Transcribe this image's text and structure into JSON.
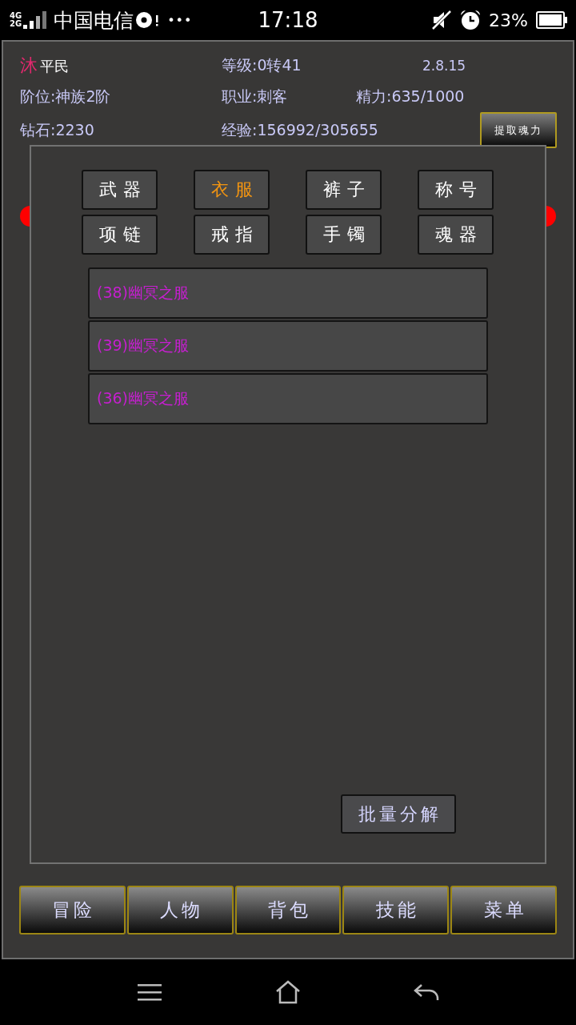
{
  "status_bar": {
    "network": [
      "4G",
      "2G"
    ],
    "carrier": "中国电信",
    "overflow": "•••",
    "time": "17:18",
    "battery": "23%"
  },
  "player": {
    "name": "沐",
    "rank": "平民",
    "level": "等级:0转41",
    "version": "2.8.15",
    "tier": "阶位:神族2阶",
    "job": "职业:刺客",
    "energy": "精力:635/1000",
    "diamonds": "钻石:2230",
    "experience": "经验:156992/305655",
    "extract_button": "提取魂力"
  },
  "dialog": {
    "tabs": [
      {
        "label": "武器",
        "selected": false
      },
      {
        "label": "衣服",
        "selected": true
      },
      {
        "label": "裤子",
        "selected": false
      },
      {
        "label": "称号",
        "selected": false
      },
      {
        "label": "项链",
        "selected": false
      },
      {
        "label": "戒指",
        "selected": false
      },
      {
        "label": "手镯",
        "selected": false
      },
      {
        "label": "魂器",
        "selected": false
      }
    ],
    "items": [
      {
        "label": "(38)幽冥之服"
      },
      {
        "label": "(39)幽冥之服"
      },
      {
        "label": "(36)幽冥之服"
      }
    ],
    "action_button": "批量分解"
  },
  "bottom_nav": [
    {
      "label": "冒险"
    },
    {
      "label": "人物"
    },
    {
      "label": "背包"
    },
    {
      "label": "技能"
    },
    {
      "label": "菜单"
    }
  ]
}
